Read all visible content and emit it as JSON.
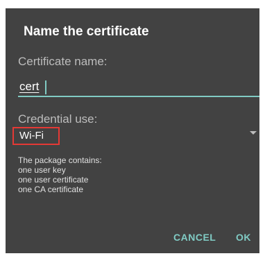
{
  "dialog": {
    "title": "Name the certificate",
    "certificate_name_label": "Certificate name:",
    "certificate_name_value": "cert",
    "credential_use_label": "Credential use:",
    "credential_use_selected": "Wi-Fi",
    "package_info": {
      "heading": "The package contains:",
      "items": [
        "one user key",
        "one user certificate",
        "one CA certificate"
      ]
    },
    "buttons": {
      "cancel": "CANCEL",
      "ok": "OK"
    }
  },
  "colors": {
    "dialog_bg": "#424242",
    "accent": "#80cbc4",
    "highlight_border": "#e53935"
  },
  "icons": {
    "dropdown": "dropdown-arrow-icon"
  }
}
